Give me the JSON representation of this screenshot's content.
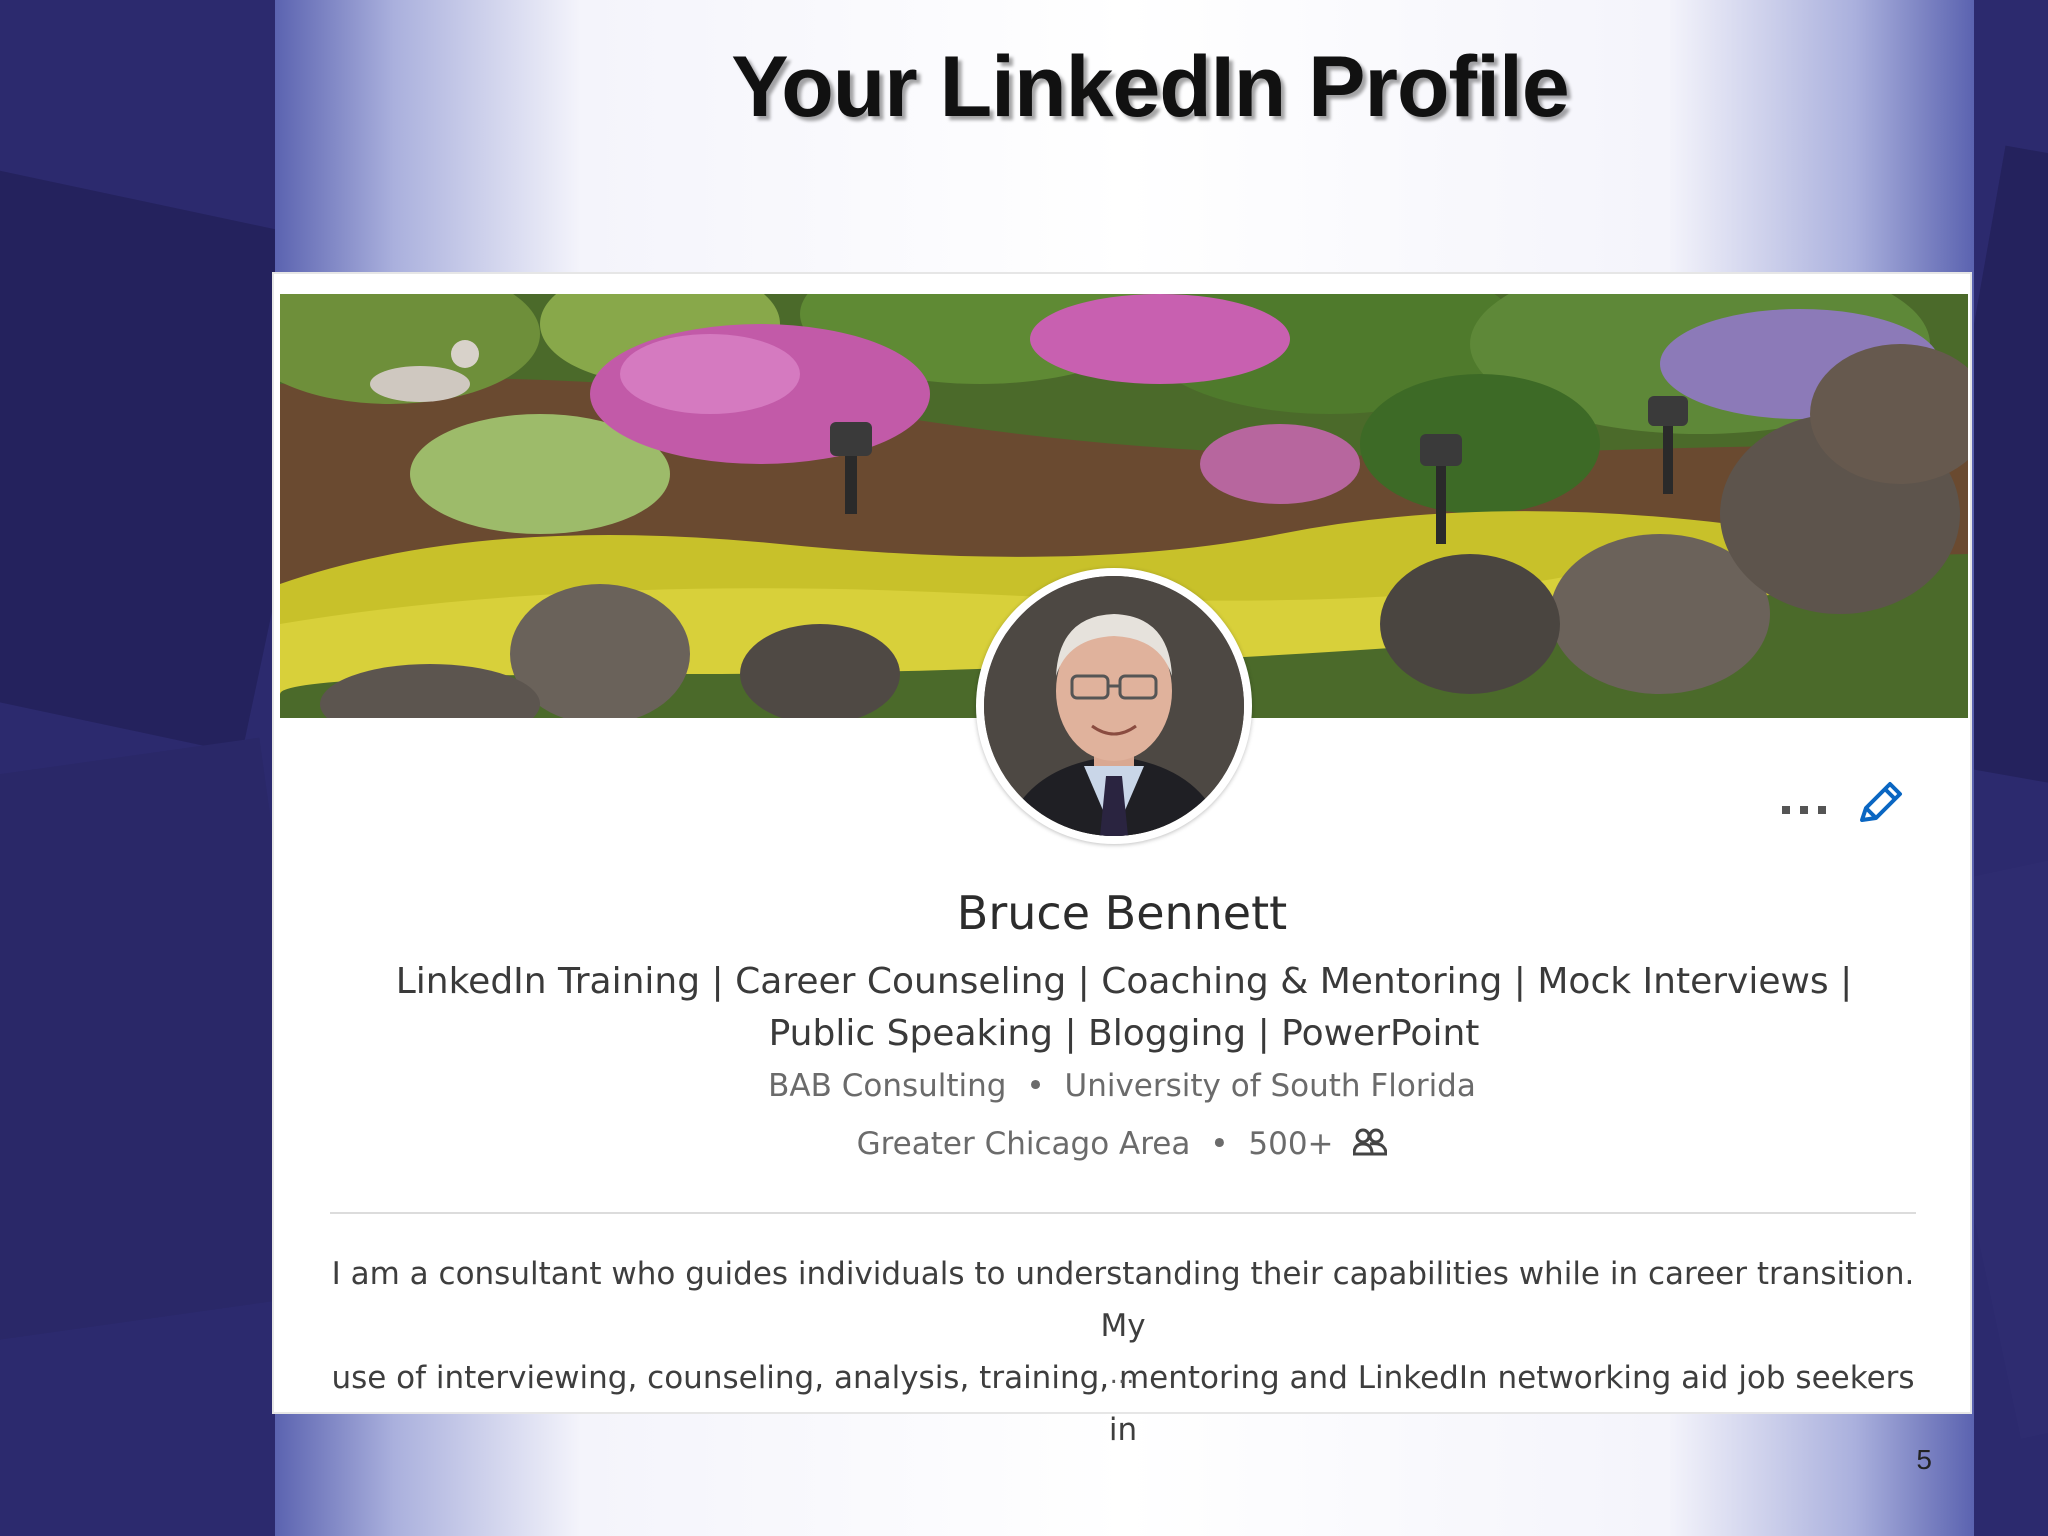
{
  "slide": {
    "title": "Your LinkedIn Profile",
    "page_number": "5"
  },
  "profile": {
    "name": "Bruce Bennett",
    "headline_line1": "LinkedIn Training | Career Counseling | Coaching & Mentoring | Mock Interviews |",
    "headline_line2": "Public Speaking | Blogging | PowerPoint",
    "company": "BAB Consulting",
    "school": "University of South Florida",
    "separator": "•",
    "location": "Greater Chicago Area",
    "connections": "500+",
    "summary_line1": "I am a consultant who guides individuals to understanding their capabilities while in career transition. My",
    "summary_line2": "use of interviewing, counseling, analysis, training, mentoring and LinkedIn networking aid job seekers in",
    "summary_more": "...",
    "icons": {
      "more": "more-icon",
      "edit": "pencil-icon",
      "connections": "connections-icon"
    }
  },
  "colors": {
    "accent": "#0a66c2",
    "background": "#2c2a6e"
  }
}
